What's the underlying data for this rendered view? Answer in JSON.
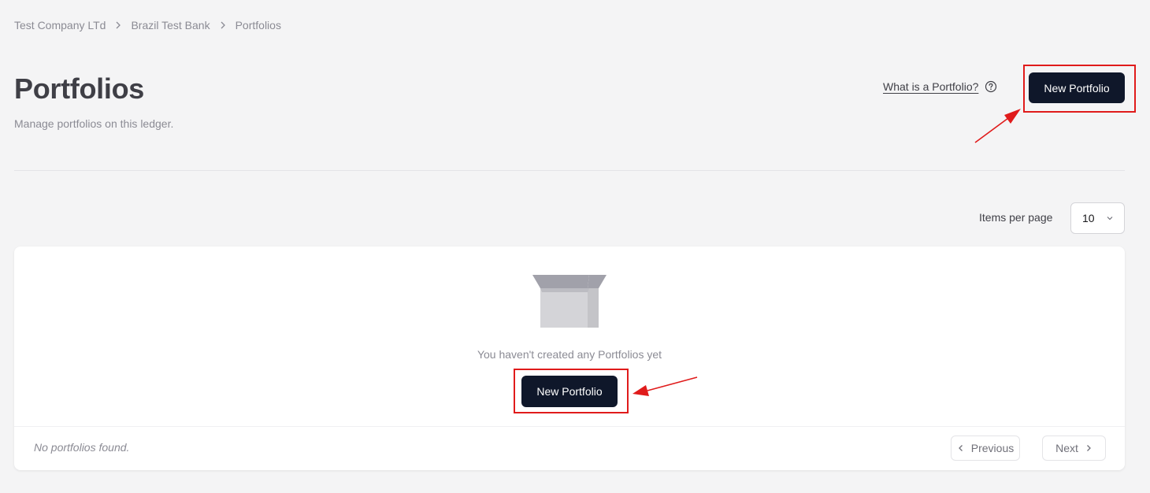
{
  "breadcrumb": {
    "items": [
      "Test Company LTd",
      "Brazil Test Bank",
      "Portfolios"
    ]
  },
  "header": {
    "title": "Portfolios",
    "subtitle": "Manage portfolios on this ledger.",
    "help_link": "What is a Portfolio?",
    "help_icon": "question-circle-icon",
    "new_button": "New Portfolio"
  },
  "pagination": {
    "items_per_page_label": "Items per page",
    "items_per_page_value": "10",
    "previous_label": "Previous",
    "next_label": "Next"
  },
  "empty_state": {
    "icon": "empty-box-icon",
    "message": "You haven't created any Portfolios yet",
    "button_label": "New Portfolio"
  },
  "footer": {
    "no_results": "No portfolios found."
  },
  "colors": {
    "primary_button": "#0f172a",
    "annotation": "#e01b1b",
    "background": "#f4f4f5"
  }
}
